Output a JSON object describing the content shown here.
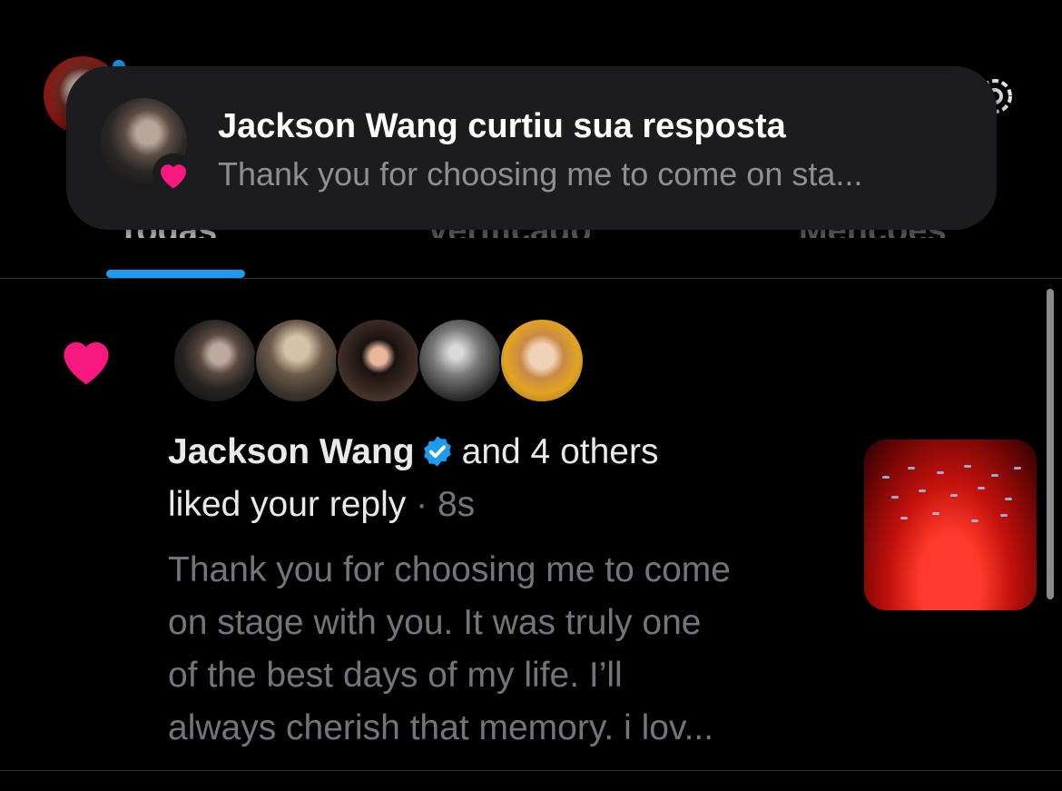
{
  "banner": {
    "title": "Jackson Wang curtiu sua resposta",
    "body": "Thank you for choosing me to come on sta..."
  },
  "tabs": [
    {
      "label": "Todas"
    },
    {
      "label": "Verificado"
    },
    {
      "label": "Menções"
    }
  ],
  "notification": {
    "user": "Jackson Wang",
    "others": "and 4 others",
    "action": "liked your reply",
    "time": "· 8s",
    "reply_lines": [
      "Thank you for choosing me to come",
      "on stage with you. It was truly one",
      "of the best days of my life. I’ll",
      "always cherish that memory.  i lov..."
    ]
  },
  "colors": {
    "accent": "#1d9bf0",
    "heart": "#f91880",
    "background": "#000000"
  },
  "icons": [
    "heart-icon",
    "verified-badge-icon",
    "settings-gear-icon"
  ]
}
